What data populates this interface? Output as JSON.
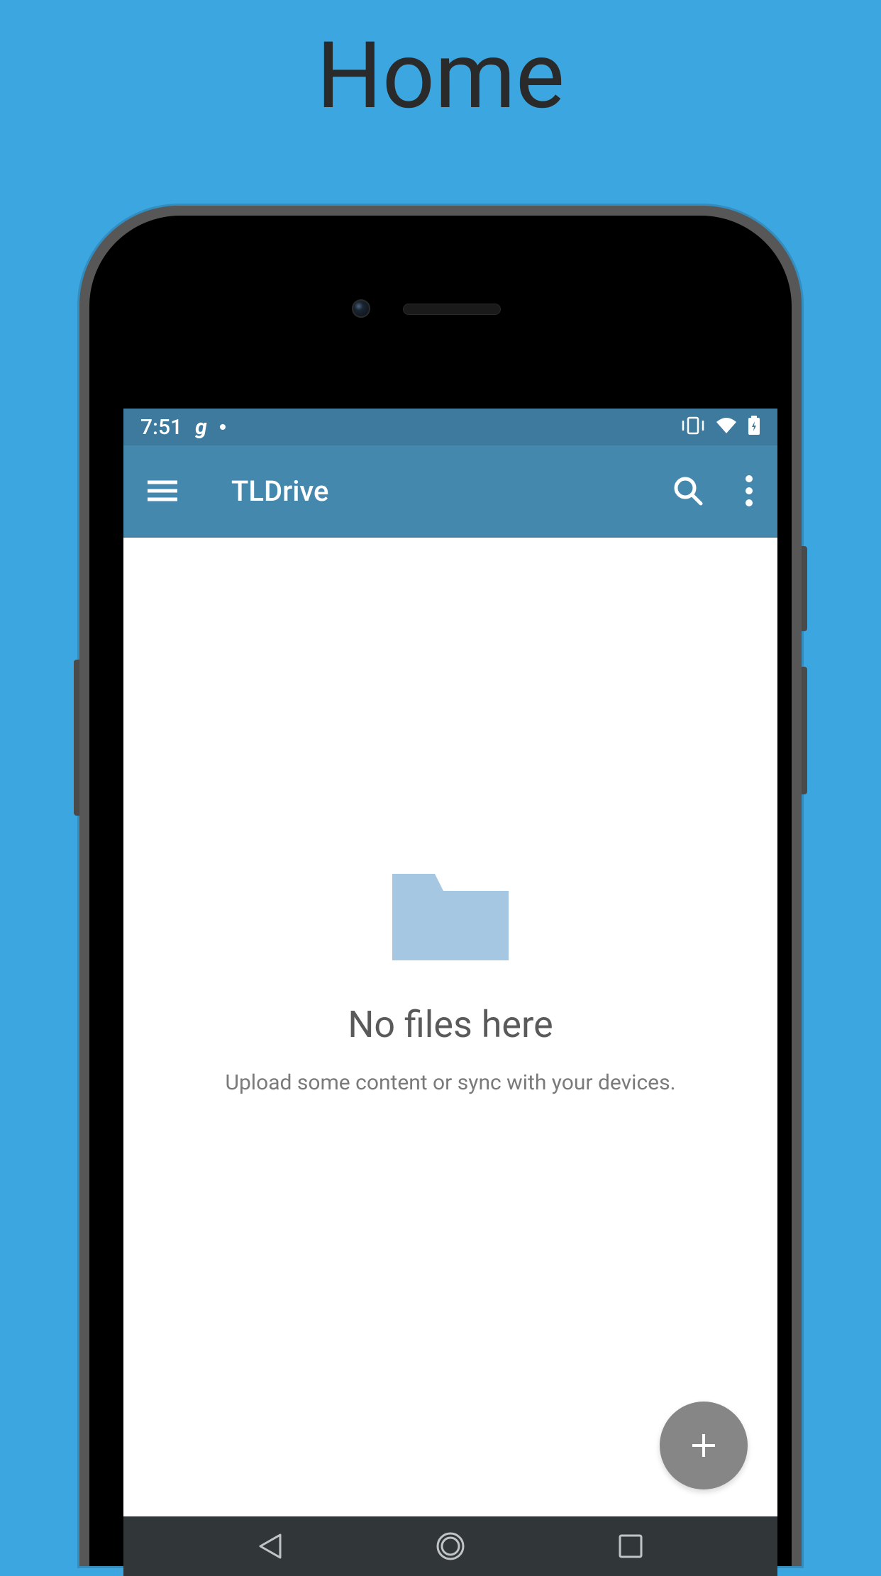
{
  "page": {
    "title": "Home"
  },
  "status_bar": {
    "time": "7:51",
    "icon_g": "g"
  },
  "app_bar": {
    "title": "TLDrive"
  },
  "empty_state": {
    "title": "No files here",
    "subtitle": "Upload some content or sync with your devices."
  },
  "colors": {
    "background": "#3ca6e0",
    "app_bar": "#4588ad",
    "status_bar": "#3e7a9e",
    "folder": "#a6c7e2",
    "fab": "#868686"
  }
}
